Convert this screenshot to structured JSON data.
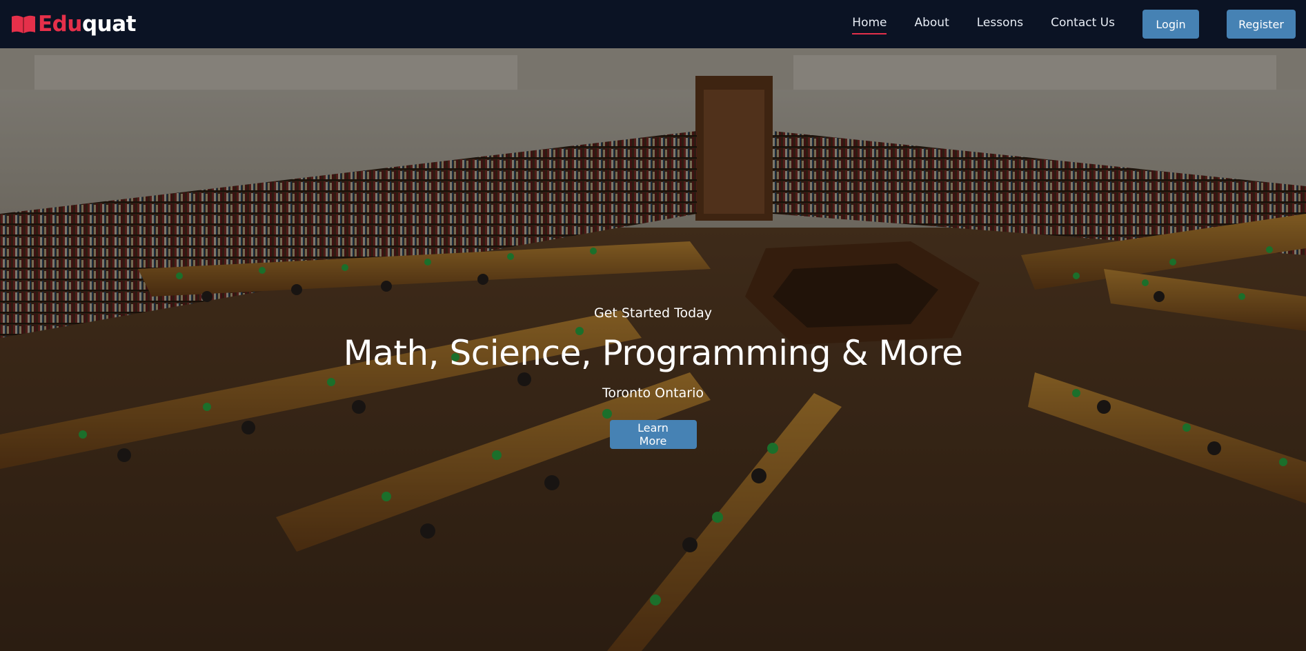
{
  "brand": {
    "part1": "Edu",
    "part2": "quat",
    "icon": "book-icon"
  },
  "nav": {
    "links": [
      "Home",
      "About",
      "Lessons",
      "Contact Us"
    ],
    "active": "Home",
    "login_label": "Login",
    "register_label": "Register"
  },
  "hero": {
    "kicker": "Get Started Today",
    "title": "Math, Science, Programming & More",
    "location": "Toronto Ontario",
    "cta_label": "Learn More"
  },
  "colors": {
    "navbar": "#0b1324",
    "accent_red": "#e5304a",
    "button_blue": "#4682b4"
  }
}
